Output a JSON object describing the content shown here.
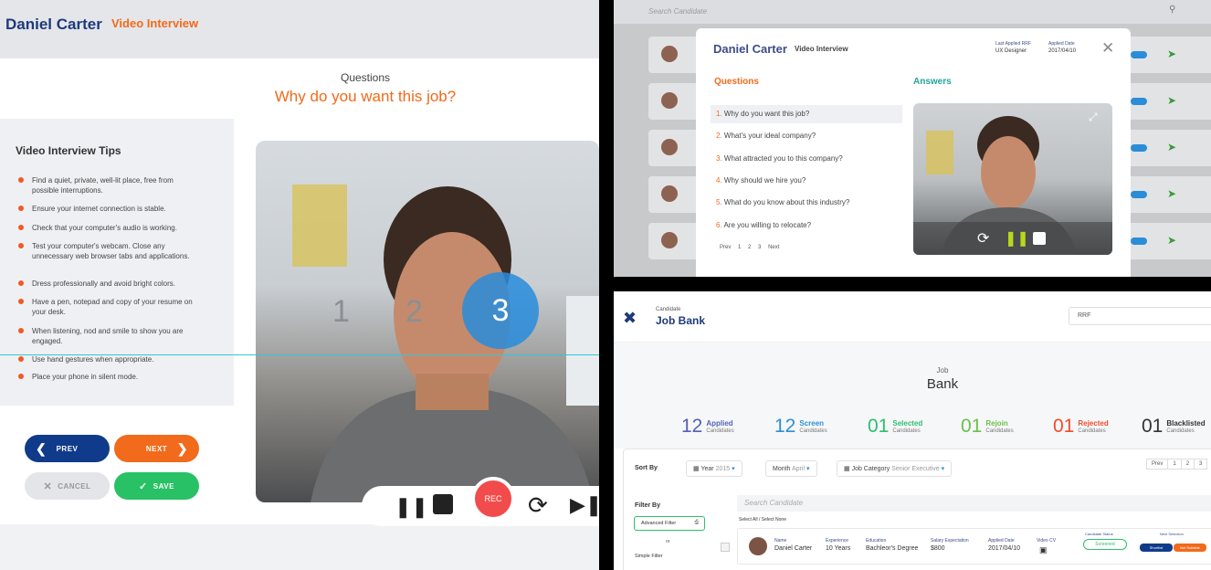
{
  "left": {
    "candidate_name": "Daniel Carter",
    "interview_label": "Video Interview",
    "questions_label": "Questions",
    "question_text": "Why do you want this job?",
    "tips_title": "Video Interview Tips",
    "tips": [
      "Find a quiet, private, well-lit place, free from possible interruptions.",
      "Ensure your internet connection is stable.",
      "Check that your computer's audio is working.",
      "Test your computer's webcam. Close any unnecessary web browser tabs and applications.",
      "Dress professionally and avoid bright colors.",
      "Have a pen, notepad and copy of your resume on your desk.",
      "When listening, nod and smile to show you are engaged.",
      "Use hand gestures when appropriate.",
      "Place your phone in silent mode."
    ],
    "buttons": {
      "prev": "PREV",
      "next": "NEXT",
      "cancel": "CANCEL",
      "save": "SAVE"
    },
    "countdown": [
      "1",
      "2",
      "3"
    ],
    "rec_label": "REC"
  },
  "top_right": {
    "search_placeholder": "Search Candidate",
    "modal": {
      "name": "Daniel Carter",
      "label": "Video Interview",
      "rrf_label": "Last Applied RRF",
      "rrf_value": "UX Designer",
      "applied_label": "Applied Date",
      "applied_value": "2017/04/10",
      "questions_header": "Questions",
      "answers_header": "Answers",
      "questions": [
        {
          "num": "1.",
          "text": "Why do you want this job?"
        },
        {
          "num": "2.",
          "text": "What's your ideal company?"
        },
        {
          "num": "3.",
          "text": "What attracted you to this company?"
        },
        {
          "num": "4.",
          "text": "Why should we hire you?"
        },
        {
          "num": "5.",
          "text": "What do you know about this industry?"
        },
        {
          "num": "6.",
          "text": "Are you willing to relocate?"
        }
      ],
      "pagination": [
        "Prev",
        "1",
        "2",
        "3",
        "Next"
      ]
    }
  },
  "bottom_right": {
    "header_small": "Candidate",
    "header_title": "Job Bank",
    "rrf_select": "RRF",
    "title_small": "Job",
    "title_big": "Bank",
    "stats": [
      {
        "num": "12",
        "l1": "Applied",
        "l2": "Candidates",
        "color": "#5560b8"
      },
      {
        "num": "12",
        "l1": "Screen",
        "l2": "Candidates",
        "color": "#2a8fd4"
      },
      {
        "num": "01",
        "l1": "Selected",
        "l2": "Candidates",
        "color": "#2cc06a"
      },
      {
        "num": "01",
        "l1": "Rejoin",
        "l2": "Candidates",
        "color": "#6cc04a"
      },
      {
        "num": "01",
        "l1": "Rejected",
        "l2": "Candidates",
        "color": "#f24b2b"
      },
      {
        "num": "01",
        "l1": "Blacklisted",
        "l2": "Candidates",
        "color": "#333333"
      }
    ],
    "sort_by": "Sort By",
    "year_label": "Year",
    "year_value": "2015",
    "month_label": "Month",
    "month_value": "April",
    "jobcat_label": "Job Category",
    "jobcat_value": "Senior Executive",
    "pagination": [
      "Prev",
      "1",
      "2",
      "3"
    ],
    "filter_by": "Filter By",
    "advanced_filter": "Advanced Filter",
    "or": "or",
    "simple_filter": "Simple Filter",
    "search_placeholder": "Search Candidate",
    "select_all": "Select All",
    "select_none": "Select None",
    "row": {
      "name_l": "Name",
      "name_v": "Daniel Carter",
      "exp_l": "Experience",
      "exp_v": "10 Years",
      "edu_l": "Education",
      "edu_v": "Bachleor's Degree",
      "sal_l": "Salary Expectation",
      "sal_v": "$800",
      "date_l": "Applied Date",
      "date_v": "2017/04/10",
      "cv_l": "Video CV",
      "status_l": "Candidate Status",
      "status_v": "Screened",
      "next_l": "Next Selection",
      "shortlist": "Shortlist",
      "not_suitable": "Not Suitable"
    }
  }
}
